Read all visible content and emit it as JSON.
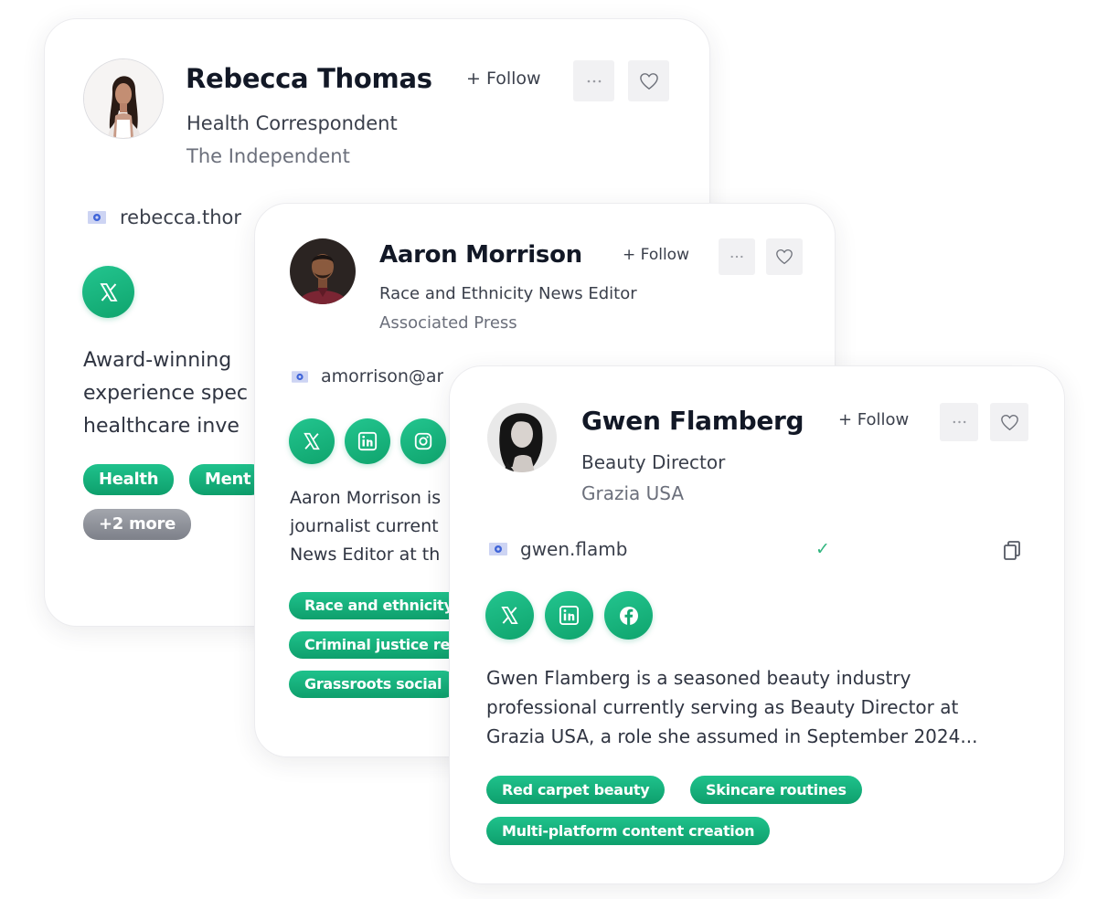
{
  "accent_color": "#15b07a",
  "cards": [
    {
      "name": "Rebecca Thomas",
      "follow_label": "+ Follow",
      "more_icon": "ellipsis-icon",
      "favorite_icon": "heart-icon",
      "role": "Health Correspondent",
      "outlet": "The Independent",
      "email": "rebecca.thor",
      "socials": [
        "x-icon"
      ],
      "bio_lines": [
        "Award-winning",
        "experience spec",
        "healthcare inve"
      ],
      "tags": [
        "Health",
        "Ment"
      ],
      "more_tags": "+2 more"
    },
    {
      "name": "Aaron Morrison",
      "follow_label": "+ Follow",
      "more_icon": "ellipsis-icon",
      "favorite_icon": "heart-icon",
      "role": "Race and Ethnicity News Editor",
      "outlet": "Associated Press",
      "email": "amorrison@ar",
      "socials": [
        "x-icon",
        "linkedin-icon",
        "instagram-icon"
      ],
      "bio_lines": [
        "Aaron Morrison is",
        "journalist current",
        "News Editor at th"
      ],
      "tags": [
        "Race and ethnicity",
        "Criminal justice re",
        "Grassroots social"
      ]
    },
    {
      "name": "Gwen Flamberg",
      "follow_label": "+ Follow",
      "more_icon": "ellipsis-icon",
      "favorite_icon": "heart-icon",
      "role": "Beauty Director",
      "outlet": "Grazia USA",
      "email": "gwen.flamb",
      "verified_mark": "✓",
      "copy_icon": "copy-icon",
      "socials": [
        "x-icon",
        "linkedin-icon",
        "facebook-icon"
      ],
      "bio_lines": [
        "Gwen Flamberg is a seasoned beauty industry",
        "professional currently serving as Beauty Director at",
        "Grazia USA, a role she assumed in September 2024..."
      ],
      "tags": [
        "Red carpet beauty",
        "Skincare routines",
        "Multi-platform content creation"
      ]
    }
  ]
}
